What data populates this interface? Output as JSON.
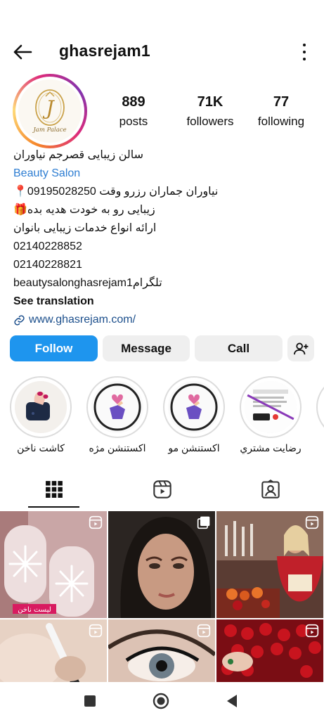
{
  "header": {
    "username": "ghasrejam1",
    "back_icon": "arrow-left-icon",
    "menu_icon": "more-vertical-icon"
  },
  "profile": {
    "avatar_brand": "Jam Palace",
    "stats": {
      "posts_count": "889",
      "posts_label": "posts",
      "followers_count": "71K",
      "followers_label": "followers",
      "following_count": "77",
      "following_label": "following"
    }
  },
  "bio": {
    "name": "سالن زیبایی قصرجم نیاوران",
    "category": "Beauty Salon",
    "line1": "نیاوران جماران  رزرو وقت 09195028250📍",
    "line2": "زیبایی رو به خودت هدیه بده🎁",
    "line3": "ارائه انواع خدمات زیبایی بانوان",
    "phone1": "02140228852",
    "phone2": "02140228821",
    "telegram": "تلگرامbeautysalonghasrejam1",
    "see_translation": "See translation",
    "website": "www.ghasrejam.com/"
  },
  "actions": {
    "follow": "Follow",
    "message": "Message",
    "call": "Call",
    "add_user_icon": "add-user-icon"
  },
  "highlights": [
    {
      "label": "کاشت ناخن"
    },
    {
      "label": "اکستنشن مژه"
    },
    {
      "label": "اکستنشن مو"
    },
    {
      "label": "رضایت مشتري"
    }
  ],
  "tabs": [
    {
      "icon": "grid-icon",
      "active": true
    },
    {
      "icon": "reels-icon",
      "active": false
    },
    {
      "icon": "tagged-icon",
      "active": false
    }
  ],
  "grid": {
    "post1_caption": "لیست ناخن"
  },
  "colors": {
    "follow_blue": "#1e95ee",
    "link_blue": "#2d7dd2",
    "button_gray": "#efefef"
  },
  "navbar": {
    "recent_icon": "square-icon",
    "home_icon": "circle-icon",
    "back_icon": "triangle-back-icon"
  }
}
